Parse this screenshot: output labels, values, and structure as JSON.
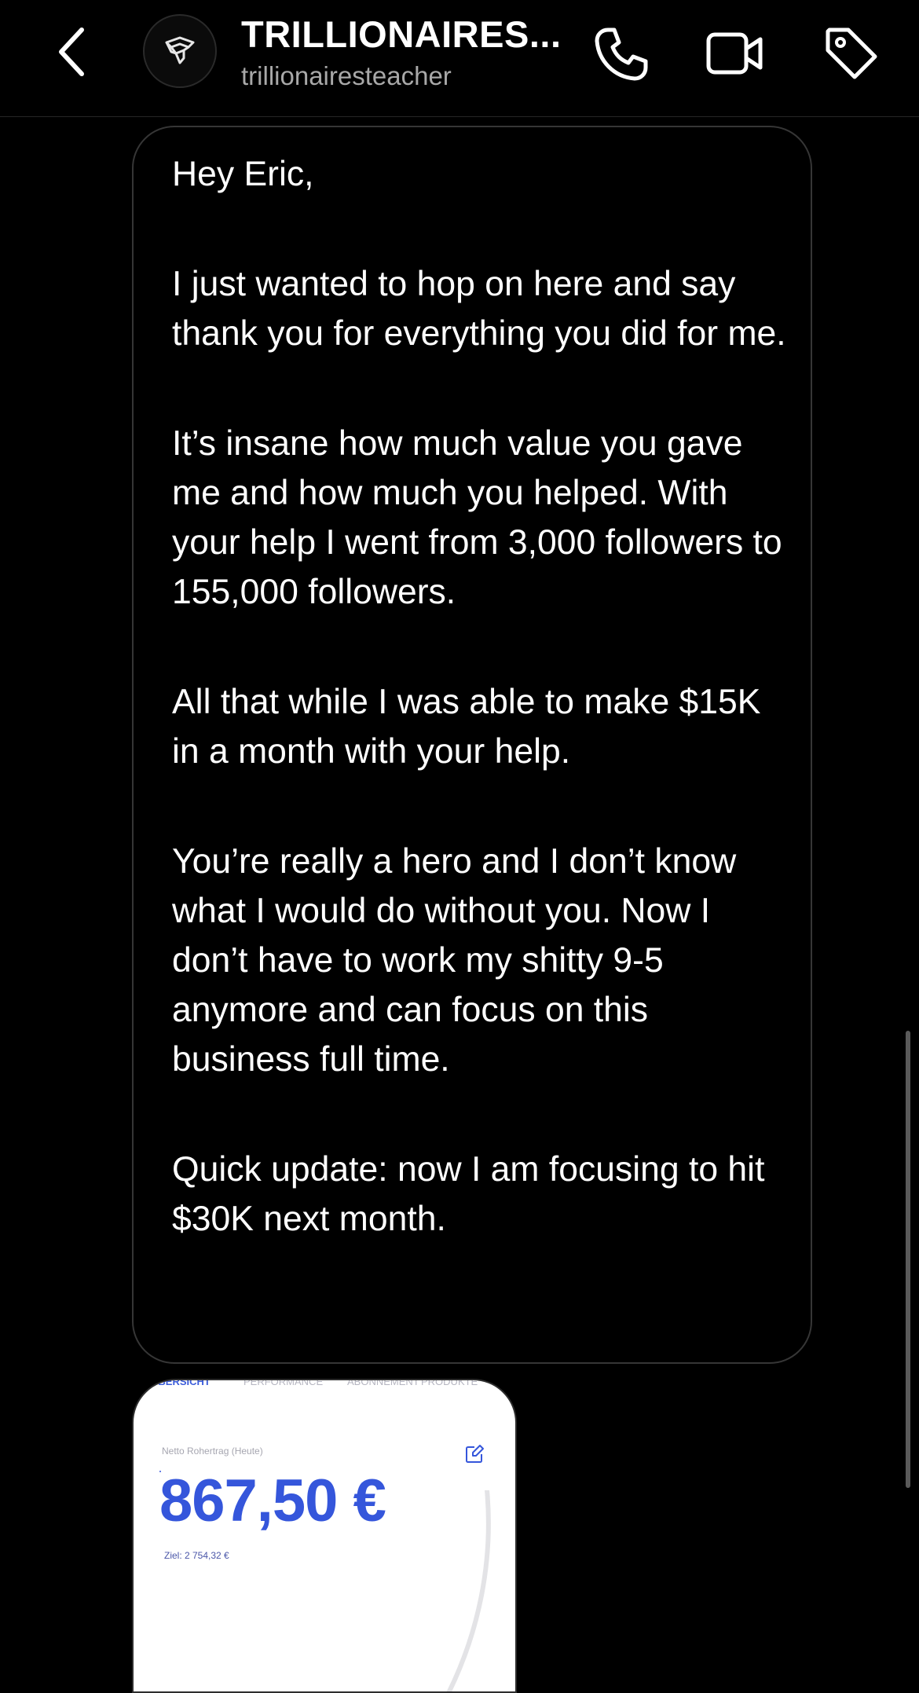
{
  "header": {
    "title": "TRILLIONAIRES...",
    "username": "trillionairesteacher",
    "back_icon": "chevron-left-icon",
    "call_icon": "phone-icon",
    "video_icon": "video-camera-icon",
    "tag_icon": "tag-icon",
    "avatar_icon": "logo-avatar-icon"
  },
  "message": {
    "paragraphs": [
      "Hey Eric,",
      "I just wanted to hop on here and say thank you for everything you did for me.",
      "It’s insane how much value you gave me and how much you helped. With your help I went from 3,000 followers to 155,000 followers.",
      "All that while I was able to make $15K in a month with your help.",
      "You’re really a hero and I don’t know what I would do without you. Now I don’t have to work my shitty 9-5 anymore and can focus on this business full time.",
      "Quick update: now I am focusing to hit $30K next month."
    ]
  },
  "attachment": {
    "tabs": [
      "ÜBERSICHT",
      "PERFORMANCE",
      "ABONNEMENT",
      "PRODUKTE"
    ],
    "label": "Netto Rohertrag (Heute)",
    "value": "867,50 €",
    "goal": "Ziel: 2 754,32 €",
    "edit_icon": "edit-icon"
  },
  "colors": {
    "background": "#000000",
    "bubble_border": "#363636",
    "accent_blue": "#3556db",
    "subtitle_gray": "#a8a8a8"
  }
}
